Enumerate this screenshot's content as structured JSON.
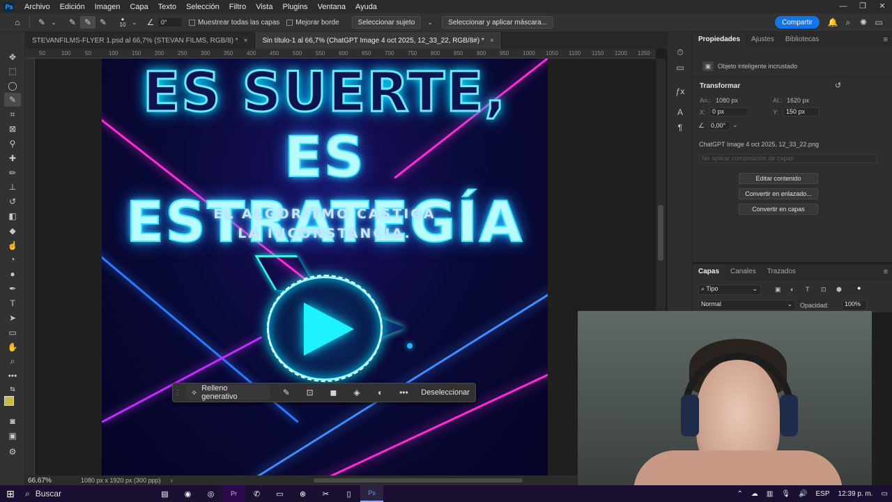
{
  "menubar": {
    "app_icon": "Ps",
    "items": [
      "Archivo",
      "Edición",
      "Imagen",
      "Capa",
      "Texto",
      "Selección",
      "Filtro",
      "Vista",
      "Plugins",
      "Ventana",
      "Ayuda"
    ]
  },
  "options": {
    "brush_size": "10",
    "angle": "0°",
    "sample_all": "Muestrear todas las capas",
    "enhance_edge": "Mejorar borde",
    "select_subject": "Seleccionar sujeto",
    "select_mask": "Seleccionar y aplicar máscara...",
    "share": "Compartir"
  },
  "tabs": [
    {
      "label": "STEVANFILMS-FLYER 1.psd al 66,7% (STEVAN FILMS, RGB/8) *",
      "close": "×"
    },
    {
      "label": "Sin título-1 al 66,7% (ChatGPT Image 4 oct 2025, 12_33_22, RGB/8#) *",
      "close": "×"
    }
  ],
  "rulers": {
    "top": [
      "50",
      "100",
      "50",
      "100",
      "150",
      "200",
      "250",
      "300",
      "350",
      "400",
      "450",
      "500",
      "550",
      "600",
      "650",
      "700",
      "750",
      "800",
      "850",
      "900",
      "950",
      "1000",
      "1050",
      "1100",
      "1150",
      "1200",
      "1250"
    ]
  },
  "canvas": {
    "headline_1": "ES SUERTE,",
    "headline_2": "ES ESTRATEGÍA",
    "subline_1": "EL ALGORITMO CASTIGA",
    "subline_2": "LA INCONSTANCIA."
  },
  "ctxbar": {
    "generative_fill": "Relleno generativo",
    "deselect": "Deseleccionar"
  },
  "status": {
    "zoom": "66.67%",
    "doc_size": "1080 px x 1920 px (300 ppp)"
  },
  "properties": {
    "tabs": [
      "Propiedades",
      "Ajustes",
      "Bibliotecas"
    ],
    "layer_type": "Objeto inteligente incrustado",
    "transform_title": "Transformar",
    "width_label": "An.:",
    "width_value": "1080 px",
    "height_label": "Al.:",
    "height_value": "1620 px",
    "x_label": "X:",
    "x_value": "0 px",
    "y_label": "Y:",
    "y_value": "150 px",
    "angle_value": "0,00°",
    "filename": "ChatGPT Image 4 oct 2025, 12_33_22.png",
    "comp_placeholder": "No aplicar composición de capas",
    "edit_contents": "Editar contenido",
    "convert_linked": "Convertir en enlazado...",
    "convert_layers": "Convertir en capas"
  },
  "layers": {
    "tabs": [
      "Capas",
      "Canales",
      "Trazados"
    ],
    "filter_kind": "Tipo",
    "blend_mode": "Normal",
    "opacity_label": "Opacidad:",
    "opacity_value": "100%"
  },
  "taskbar": {
    "search": "Buscar",
    "lang": "ESP",
    "time": "12:39 p. m."
  },
  "colors": {
    "accent": "#1473e6",
    "neon_cyan": "#1ff2ff",
    "neon_magenta": "#ff2bd6",
    "foreground_swatch": "#c8b84a"
  }
}
